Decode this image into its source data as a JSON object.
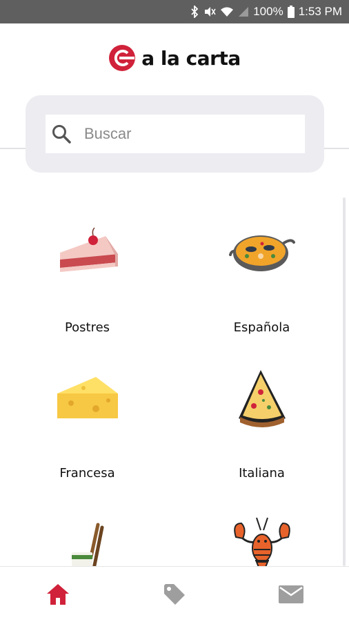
{
  "status_bar": {
    "battery": "100%",
    "time": "1:53 PM"
  },
  "brand": {
    "name": "a la carta",
    "color": "#d0223a"
  },
  "search": {
    "placeholder": "Buscar"
  },
  "categories": [
    {
      "label": "Postres",
      "icon": "cake-slice-icon"
    },
    {
      "label": "Española",
      "icon": "paella-icon"
    },
    {
      "label": "Francesa",
      "icon": "cheese-icon"
    },
    {
      "label": "Italiana",
      "icon": "pizza-slice-icon"
    },
    {
      "label": "",
      "icon": "sushi-chopsticks-icon"
    },
    {
      "label": "",
      "icon": "lobster-icon"
    }
  ],
  "bottom_nav": [
    {
      "name": "home",
      "icon": "home-icon",
      "active": true
    },
    {
      "name": "offers",
      "icon": "tag-icon",
      "active": false
    },
    {
      "name": "messages",
      "icon": "mail-icon",
      "active": false
    }
  ],
  "colors": {
    "accent": "#d0223a",
    "inactive": "#9e9e9e",
    "status_bar": "#5f5f5f"
  }
}
